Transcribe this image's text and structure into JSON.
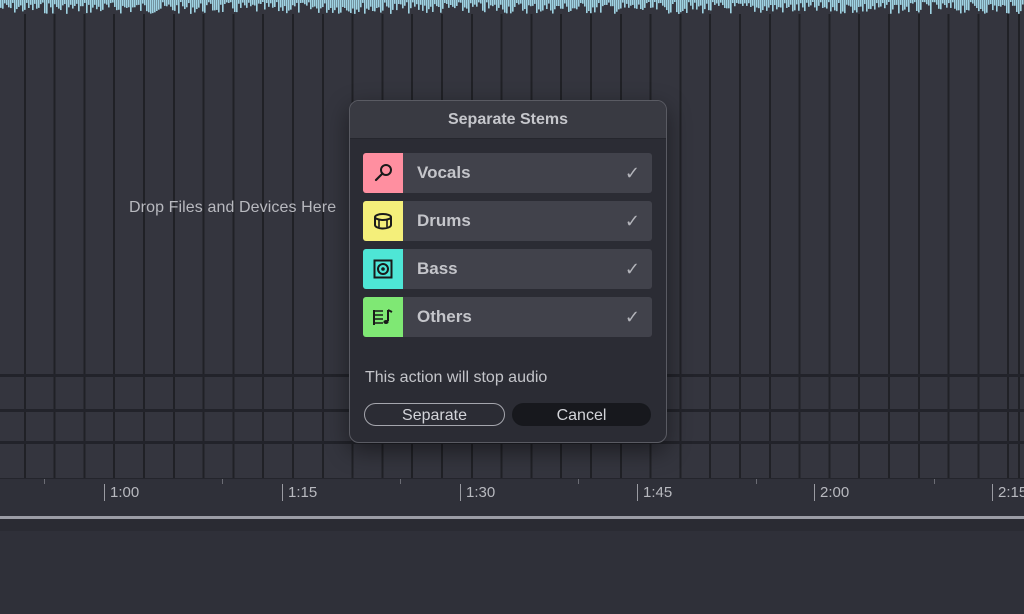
{
  "arrangement": {
    "drop_hint": "Drop Files and Devices Here"
  },
  "timeline": {
    "markers": [
      "1:00",
      "1:15",
      "1:30",
      "1:45",
      "2:00",
      "2:15"
    ]
  },
  "dialog": {
    "title": "Separate Stems",
    "stems": [
      {
        "label": "Vocals",
        "color": "#ff8fa0",
        "icon": "microphone-icon",
        "checked": true,
        "check": "✓"
      },
      {
        "label": "Drums",
        "color": "#f4ef7a",
        "icon": "drum-icon",
        "checked": true,
        "check": "✓"
      },
      {
        "label": "Bass",
        "color": "#4ee6d6",
        "icon": "speaker-icon",
        "checked": true,
        "check": "✓"
      },
      {
        "label": "Others",
        "color": "#7fe874",
        "icon": "sheet-music-icon",
        "checked": true,
        "check": "✓"
      }
    ],
    "message": "This action will stop audio",
    "separate_label": "Separate",
    "cancel_label": "Cancel"
  },
  "colors": {
    "waveform": "#9fd3e3",
    "background": "#2f3039"
  }
}
